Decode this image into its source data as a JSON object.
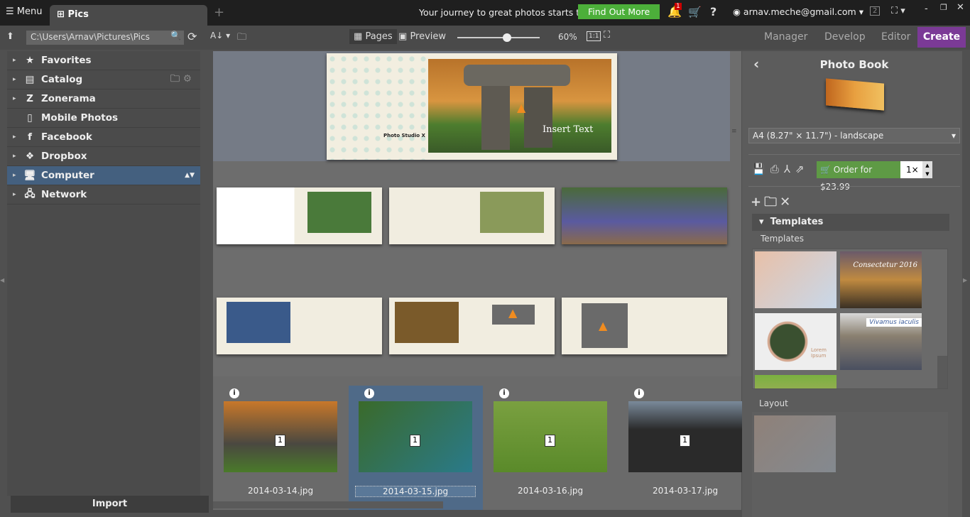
{
  "topbar": {
    "menu": "Menu",
    "tab": "Pics",
    "promo": "Your journey to great photos starts today",
    "cta": "Find Out More",
    "notifications": "1",
    "account": "arnav.meche@gmail.com",
    "monitor": "2"
  },
  "toolbar": {
    "path": "C:\\Users\\Arnav\\Pictures\\Pics",
    "pages": "Pages",
    "preview": "Preview",
    "zoom_percent": 60,
    "zoom_label": "60%",
    "one_to_one": "1:1",
    "modes": [
      "Manager",
      "Develop",
      "Editor",
      "Create"
    ],
    "active_mode": "Create",
    "accent": "#7b3a96"
  },
  "sidebar": {
    "items": [
      {
        "label": "Favorites",
        "icon": "star-icon"
      },
      {
        "label": "Catalog",
        "icon": "catalog-icon"
      },
      {
        "label": "Zonerama",
        "icon": "zonerama-icon"
      },
      {
        "label": "Mobile Photos",
        "icon": "phone-icon"
      },
      {
        "label": "Facebook",
        "icon": "facebook-icon"
      },
      {
        "label": "Dropbox",
        "icon": "dropbox-icon"
      },
      {
        "label": "Computer",
        "icon": "computer-icon"
      },
      {
        "label": "Network",
        "icon": "network-icon"
      }
    ],
    "selected": "Computer",
    "import": "Import"
  },
  "cover": {
    "text": "Insert Text",
    "logo": "Photo Studio X"
  },
  "filmstrip": [
    {
      "name": "2014-03-14.jpg",
      "count": "1"
    },
    {
      "name": "2014-03-15.jpg",
      "count": "1"
    },
    {
      "name": "2014-03-16.jpg",
      "count": "1"
    },
    {
      "name": "2014-03-17.jpg",
      "count": "1"
    }
  ],
  "right": {
    "title": "Photo Book",
    "format": "A4 (8.27\" × 11.7\") - landscape",
    "order": "Order for $23.99",
    "quantity": "1×",
    "section": "Templates",
    "templates_label": "Templates",
    "layout_label": "Layout",
    "template_texts": [
      "Consectetur 2016",
      "Vivamus iaculis",
      "Lorem Ipsum"
    ]
  }
}
